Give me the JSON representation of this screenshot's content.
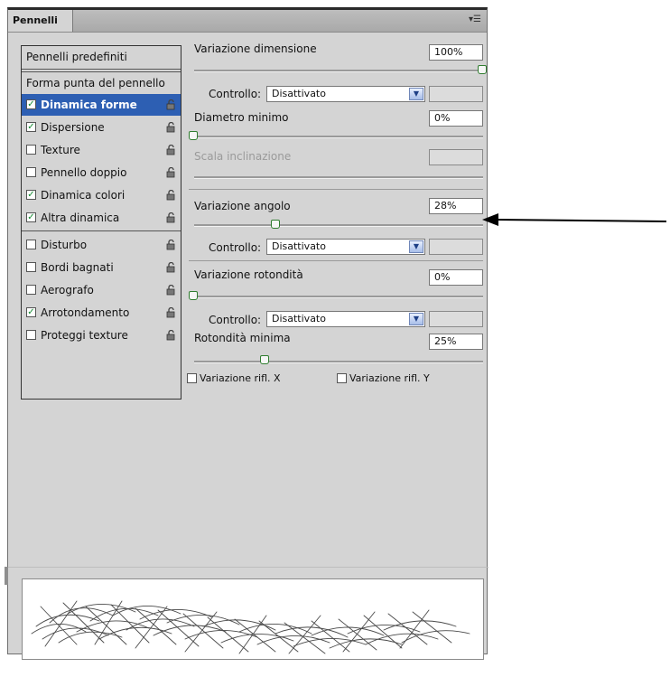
{
  "panel": {
    "tab_label": "Pennelli",
    "menu_icon": "panel-menu-icon",
    "presets_label": "Pennelli predefiniti",
    "tip_shape_label": "Forma punta del pennello"
  },
  "list": {
    "items": [
      {
        "label": "Dinamica forme",
        "checked": true,
        "selected": true
      },
      {
        "label": "Dispersione",
        "checked": true
      },
      {
        "label": "Texture",
        "checked": false
      },
      {
        "label": "Pennello doppio",
        "checked": false
      },
      {
        "label": "Dinamica colori",
        "checked": true
      },
      {
        "label": "Altra dinamica",
        "checked": true
      },
      {
        "label": "Disturbo",
        "checked": false
      },
      {
        "label": "Bordi bagnati",
        "checked": false
      },
      {
        "label": "Aerografo",
        "checked": false
      },
      {
        "label": "Arrotondamento",
        "checked": true
      },
      {
        "label": "Proteggi texture",
        "checked": false
      }
    ]
  },
  "controls": {
    "size_jitter": {
      "label": "Variazione dimensione",
      "value": "100%",
      "level": 1.0
    },
    "size_control": {
      "label": "Controllo:",
      "value": "Disattivato"
    },
    "min_diameter": {
      "label": "Diametro minimo",
      "value": "0%",
      "level": 0.0
    },
    "tilt_scale": {
      "label": "Scala inclinazione",
      "value": ""
    },
    "angle_jitter": {
      "label": "Variazione angolo",
      "value": "28%",
      "level": 0.28
    },
    "angle_control": {
      "label": "Controllo:",
      "value": "Disattivato"
    },
    "roundness_jitter": {
      "label": "Variazione rotondità",
      "value": "0%",
      "level": 0.0
    },
    "roundness_control": {
      "label": "Controllo:",
      "value": "Disattivato"
    },
    "min_roundness": {
      "label": "Rotondità minima",
      "value": "25%",
      "level": 0.25
    },
    "flip_x": {
      "label": "Variazione rifl. X",
      "checked": false
    },
    "flip_y": {
      "label": "Variazione rifl. Y",
      "checked": false
    }
  },
  "colors": {
    "selected": "#2d5fb3",
    "check": "#118a2f",
    "panel": "#d4d4d4"
  }
}
